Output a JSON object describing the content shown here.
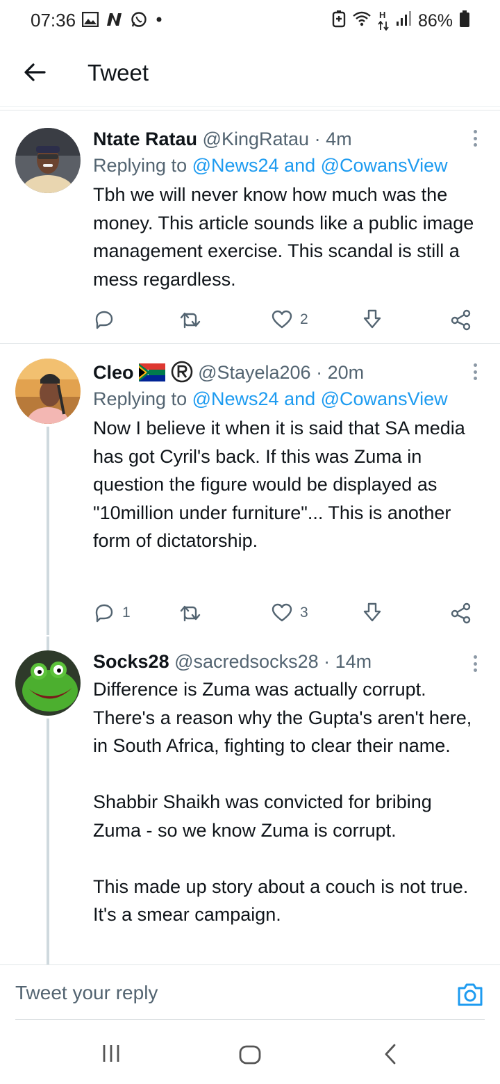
{
  "status_bar": {
    "time": "07:36",
    "battery": "86%",
    "network_label": "H",
    "icons": [
      "gallery-icon",
      "n-app-icon",
      "whatsapp-icon",
      "dot-icon",
      "battery-saver-icon",
      "wifi-icon",
      "data-arrows-icon",
      "signal-icon",
      "battery-icon"
    ]
  },
  "header": {
    "title": "Tweet"
  },
  "tweets": [
    {
      "name": "Ntate Ratau",
      "handle": "@KingRatau",
      "dot": "·",
      "time": "4m",
      "replying_prefix": "Replying to",
      "replying_mentions": "@News24 and @CowansView",
      "text": "Tbh we will never know how much was the money. This article sounds like a public image management exercise. This scandal is still a mess regardless.",
      "reply_count": "",
      "like_count": "2"
    },
    {
      "name": "Cleo",
      "name_emojis": "flag-za-icon, registered-icon",
      "handle": "@Stayela206",
      "dot": "·",
      "time": "20m",
      "replying_prefix": "Replying to",
      "replying_mentions": "@News24 and @CowansView",
      "text": "Now I believe it when it is said that SA media has got Cyril's back. If this was Zuma in question the figure would be displayed as \"10million under furniture\"... This is another form of dictatorship.",
      "reply_count": "1",
      "like_count": "3"
    },
    {
      "name": "Socks28",
      "handle": "@sacredsocks28",
      "dot": "·",
      "time": "14m",
      "text": "Difference is Zuma was actually corrupt. There's a reason why the Gupta's aren't here, in South Africa, fighting to clear their name.\n\nShabbir Shaikh was convicted for bribing Zuma - so we know Zuma is corrupt.\n\nThis made up story about a couch is not true. It's a smear campaign."
    }
  ],
  "reply_bar": {
    "placeholder": "Tweet your reply"
  },
  "colors": {
    "link": "#1d9bf0",
    "secondary": "#536471",
    "text": "#0f1419",
    "thread": "#cfd9de"
  }
}
